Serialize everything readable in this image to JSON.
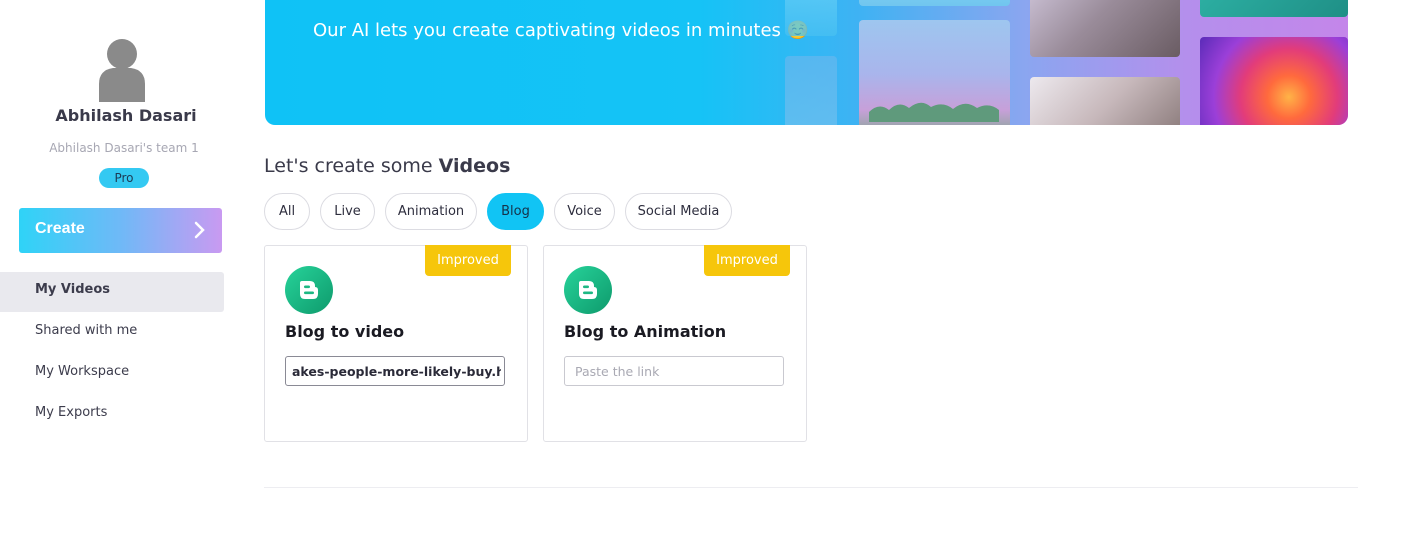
{
  "user": {
    "name": "Abhilash Dasari",
    "team": "Abhilash Dasari's team 1",
    "plan": "Pro"
  },
  "sidebar": {
    "create_label": "Create",
    "items": [
      {
        "label": "My Videos",
        "active": true
      },
      {
        "label": "Shared with me",
        "active": false
      },
      {
        "label": "My Workspace",
        "active": false
      },
      {
        "label": "My Exports",
        "active": false
      }
    ]
  },
  "banner": {
    "subtitle": "Our AI lets you create captivating videos in minutes ☺️"
  },
  "section": {
    "title_prefix": "Let's create some ",
    "title_bold": "Videos"
  },
  "filters": [
    {
      "label": "All",
      "active": false
    },
    {
      "label": "Live",
      "active": false
    },
    {
      "label": "Animation",
      "active": false
    },
    {
      "label": "Blog",
      "active": true
    },
    {
      "label": "Voice",
      "active": false
    },
    {
      "label": "Social Media",
      "active": false
    }
  ],
  "cards": [
    {
      "title": "Blog to video",
      "badge": "Improved",
      "input_value": "akes-people-more-likely-buy.html",
      "input_placeholder": "Paste the link"
    },
    {
      "title": "Blog to Animation",
      "badge": "Improved",
      "input_value": "",
      "input_placeholder": "Paste the link"
    }
  ],
  "colors": {
    "accent": "#11c4f4",
    "badge": "#f6c60b",
    "blogger_green": "#1db883"
  }
}
